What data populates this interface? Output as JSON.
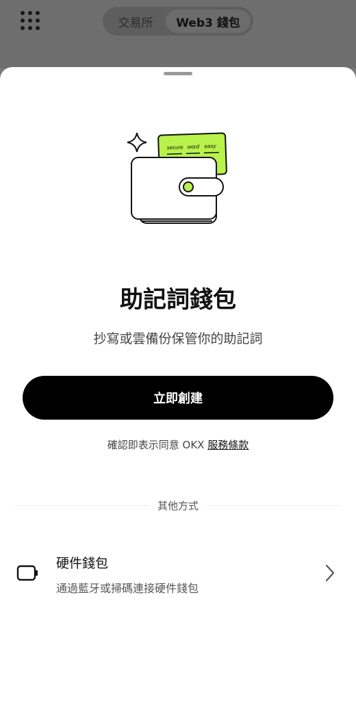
{
  "header": {
    "tabs": [
      {
        "label": "交易所",
        "active": false
      },
      {
        "label": "Web3 錢包",
        "active": true
      }
    ]
  },
  "illustration": {
    "card_words": [
      "secure",
      "word",
      "easy"
    ],
    "accent_color": "#b8f24a"
  },
  "sheet": {
    "title": "助記詞錢包",
    "subtitle": "抄寫或雲備份保管你的助記詞",
    "primary_button": "立即創建",
    "terms_prefix": "確認即表示同意 OKX ",
    "terms_link": "服務條款",
    "other_methods_label": "其他方式",
    "hardware": {
      "title": "硬件錢包",
      "description": "通過藍牙或掃碼連接硬件錢包"
    }
  }
}
